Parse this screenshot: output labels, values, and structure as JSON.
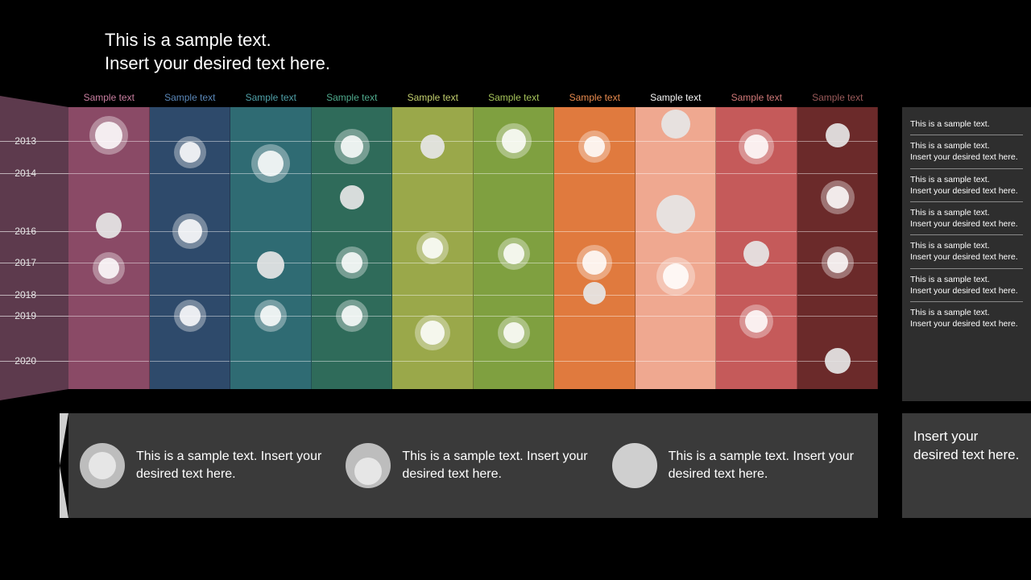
{
  "title_line1": "This is a sample text.",
  "title_line2": "Insert your desired text here.",
  "columns": [
    {
      "label": "Sample text",
      "color": "#8a4a66",
      "label_color": "#c97ea0"
    },
    {
      "label": "Sample text",
      "color": "#2e4a6b",
      "label_color": "#5a87b8"
    },
    {
      "label": "Sample text",
      "color": "#2f6b73",
      "label_color": "#4fa0a8"
    },
    {
      "label": "Sample text",
      "color": "#2f6b5a",
      "label_color": "#4faa8d"
    },
    {
      "label": "Sample text",
      "color": "#9aa84a",
      "label_color": "#c3cf6e"
    },
    {
      "label": "Sample text",
      "color": "#7fa040",
      "label_color": "#a6c45a"
    },
    {
      "label": "Sample text",
      "color": "#e07a3e",
      "label_color": "#e88a4e"
    },
    {
      "label": "Sample text",
      "color": "#efa890",
      "label_color": "#f6f6f6"
    },
    {
      "label": "Sample text",
      "color": "#c55a5a",
      "label_color": "#d07878"
    },
    {
      "label": "Sample text",
      "color": "#6b2a2a",
      "label_color": "#9a5a5a"
    }
  ],
  "years": [
    "2013",
    "2014",
    "2016",
    "2017",
    "2018",
    "2019",
    "2020"
  ],
  "year_positions": [
    12,
    23.5,
    44,
    55,
    66.5,
    74,
    90
  ],
  "row_lines": [
    12,
    23.5,
    44,
    55,
    66.5,
    74,
    90
  ],
  "bubbles": [
    {
      "col": 0,
      "y": 10,
      "out": 48,
      "in": 34
    },
    {
      "col": 0,
      "y": 42,
      "out": 0,
      "in": 32,
      "solid": true
    },
    {
      "col": 0,
      "y": 57,
      "out": 40,
      "in": 26
    },
    {
      "col": 1,
      "y": 16,
      "out": 40,
      "in": 26
    },
    {
      "col": 1,
      "y": 44,
      "out": 44,
      "in": 30
    },
    {
      "col": 1,
      "y": 74,
      "out": 40,
      "in": 26
    },
    {
      "col": 2,
      "y": 20,
      "out": 48,
      "in": 32
    },
    {
      "col": 2,
      "y": 56,
      "out": 0,
      "in": 34,
      "solid": true
    },
    {
      "col": 2,
      "y": 74,
      "out": 40,
      "in": 26
    },
    {
      "col": 3,
      "y": 14,
      "out": 44,
      "in": 28
    },
    {
      "col": 3,
      "y": 32,
      "out": 0,
      "in": 30,
      "solid": true
    },
    {
      "col": 3,
      "y": 55,
      "out": 40,
      "in": 26
    },
    {
      "col": 3,
      "y": 74,
      "out": 40,
      "in": 26
    },
    {
      "col": 4,
      "y": 14,
      "out": 0,
      "in": 30,
      "solid": true
    },
    {
      "col": 4,
      "y": 50,
      "out": 40,
      "in": 26
    },
    {
      "col": 4,
      "y": 80,
      "out": 44,
      "in": 30
    },
    {
      "col": 5,
      "y": 12,
      "out": 44,
      "in": 30
    },
    {
      "col": 5,
      "y": 52,
      "out": 40,
      "in": 26
    },
    {
      "col": 5,
      "y": 80,
      "out": 40,
      "in": 26
    },
    {
      "col": 6,
      "y": 14,
      "out": 40,
      "in": 26
    },
    {
      "col": 6,
      "y": 55,
      "out": 44,
      "in": 30
    },
    {
      "col": 6,
      "y": 66,
      "out": 0,
      "in": 28,
      "solid": true
    },
    {
      "col": 7,
      "y": 6,
      "out": 0,
      "in": 36,
      "solid": true
    },
    {
      "col": 7,
      "y": 38,
      "out": 0,
      "in": 48,
      "solid": true
    },
    {
      "col": 7,
      "y": 60,
      "out": 48,
      "in": 32
    },
    {
      "col": 8,
      "y": 14,
      "out": 44,
      "in": 30
    },
    {
      "col": 8,
      "y": 52,
      "out": 0,
      "in": 32,
      "solid": true
    },
    {
      "col": 8,
      "y": 76,
      "out": 42,
      "in": 28
    },
    {
      "col": 9,
      "y": 10,
      "out": 0,
      "in": 30,
      "solid": true
    },
    {
      "col": 9,
      "y": 32,
      "out": 42,
      "in": 28
    },
    {
      "col": 9,
      "y": 55,
      "out": 40,
      "in": 26
    },
    {
      "col": 9,
      "y": 90,
      "out": 0,
      "in": 32,
      "solid": true
    }
  ],
  "side_list": [
    "This is a sample text.",
    "This is a sample text.\nInsert your desired text here.",
    "This is a sample text.\nInsert your desired text here.",
    "This is a sample text.\nInsert your desired text here.",
    "This is a sample text.\nInsert your desired text here.",
    "This is a sample text.\nInsert your desired text here.",
    "This is a sample text.\nInsert your desired text here."
  ],
  "legend": [
    {
      "style": "single",
      "text": "This is a sample text. Insert your desired text here."
    },
    {
      "style": "double",
      "text": "This is a sample text. Insert your desired text here."
    },
    {
      "style": "solid",
      "text": "This is a sample text. Insert your desired text here."
    }
  ],
  "side_box": "Insert your desired text here."
}
